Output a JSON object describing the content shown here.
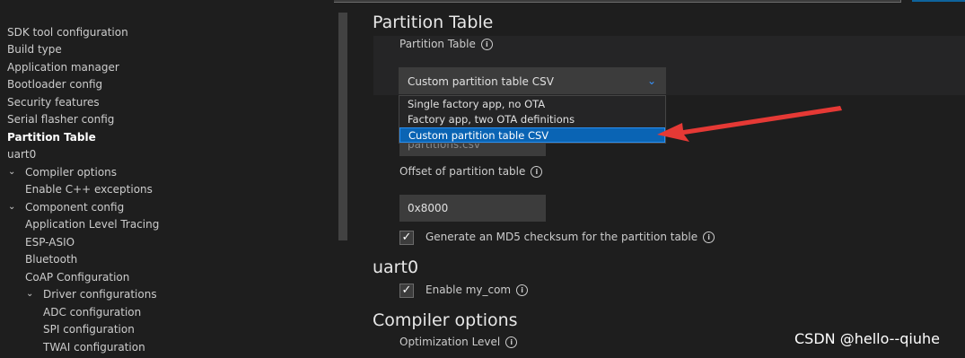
{
  "sidebar": {
    "items": [
      {
        "label": "SDK tool configuration"
      },
      {
        "label": "Build type"
      },
      {
        "label": "Application manager"
      },
      {
        "label": "Bootloader config"
      },
      {
        "label": "Security features"
      },
      {
        "label": "Serial flasher config"
      },
      {
        "label": "Partition Table"
      },
      {
        "label": "uart0"
      },
      {
        "label": "Compiler options"
      },
      {
        "label": "Enable C++ exceptions"
      },
      {
        "label": "Component config"
      },
      {
        "label": "Application Level Tracing"
      },
      {
        "label": "ESP-ASIO"
      },
      {
        "label": "Bluetooth"
      },
      {
        "label": "CoAP Configuration"
      },
      {
        "label": "Driver configurations"
      },
      {
        "label": "ADC configuration"
      },
      {
        "label": "SPI configuration"
      },
      {
        "label": "TWAI configuration"
      }
    ]
  },
  "main": {
    "partition_section_title": "Partition Table",
    "partition_table_label": "Partition Table",
    "partition_select_value": "Custom partition table CSV",
    "partition_options": [
      "Single factory app, no OTA",
      "Factory app, two OTA definitions",
      "Custom partition table CSV"
    ],
    "csv_file_value": "partitions.csv",
    "offset_label": "Offset of partition table",
    "offset_value": "0x8000",
    "md5_label": "Generate an MD5 checksum for the partition table",
    "uart_section_title": "uart0",
    "enable_my_com_label": "Enable my_com",
    "compiler_section_title": "Compiler options",
    "optimization_level_label": "Optimization Level"
  },
  "icons": {
    "info": "info-icon",
    "chevron": "chevron-down-icon",
    "check": "check-icon"
  },
  "watermark": "CSDN @hello--qiuhe",
  "colors": {
    "background": "#1e1e1e",
    "selected_option": "#0a64b4",
    "accent": "#3794ff",
    "arrow": "#e53935"
  }
}
